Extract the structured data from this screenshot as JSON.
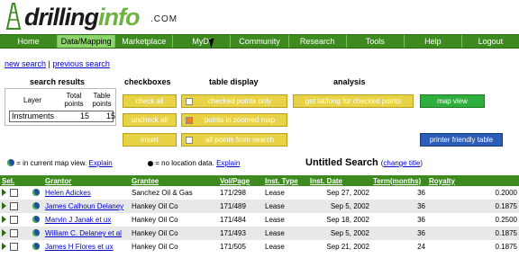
{
  "brand": {
    "name_left": "drilling",
    "name_right": "info",
    "suffix": ".COM"
  },
  "nav": [
    "Home",
    "Data/Mapping",
    "Marketplace",
    "MyDI",
    "Community",
    "Research",
    "Tools",
    "Help",
    "Logout"
  ],
  "links": {
    "new_search": "new search",
    "sep": "|",
    "previous_search": "previous search"
  },
  "sections": {
    "search_results": "search results",
    "checkboxes": "checkboxes",
    "table_display": "table display",
    "analysis": "analysis"
  },
  "results_panel": {
    "col_layer": "Layer",
    "col_total": "Total points",
    "col_table": "Table points",
    "layer": "Instruments",
    "total": "15",
    "table": "15"
  },
  "buttons": {
    "check_all": "check all",
    "uncheck_all": "uncheck all",
    "insert": "insert",
    "checked_only": "checked points only",
    "zoomed_map": "points in zoomed map",
    "all_points": "all points from search",
    "get_latlong": "get lat/long for checked points",
    "map_view": "map view",
    "printer": "printer friendly table"
  },
  "legend": {
    "in_map": "= in current map view.",
    "no_loc": "= no location data.",
    "explain": "Explain"
  },
  "title": {
    "text": "Untitled Search",
    "change": "change title"
  },
  "table": {
    "headers": [
      "Sel.",
      "",
      "Grantor",
      "Grantee",
      "Vol/Page",
      "Inst. Type",
      "Inst. Date",
      "Term(months)",
      "Royalty"
    ],
    "rows": [
      [
        "Helen Adickes",
        "Sanchez Oil & Gas",
        "171/298",
        "Lease",
        "Sep 27, 2002",
        "36",
        "0.2000"
      ],
      [
        "James Calhoun Delaney",
        "Hankey Oil Co",
        "171/489",
        "Lease",
        "Sep 5, 2002",
        "36",
        "0.1875"
      ],
      [
        "Marvin J Janak et ux",
        "Hankey Oil Co",
        "171/484",
        "Lease",
        "Sep 18, 2002",
        "36",
        "0.2500"
      ],
      [
        "William C. Delaney et al",
        "Hankey Oil Co",
        "171/493",
        "Lease",
        "Sep 5, 2002",
        "36",
        "0.1875"
      ],
      [
        "James H Flores et ux",
        "Hankey Oil Co",
        "171/505",
        "Lease",
        "Sep 21, 2002",
        "24",
        "0.1875"
      ]
    ]
  }
}
